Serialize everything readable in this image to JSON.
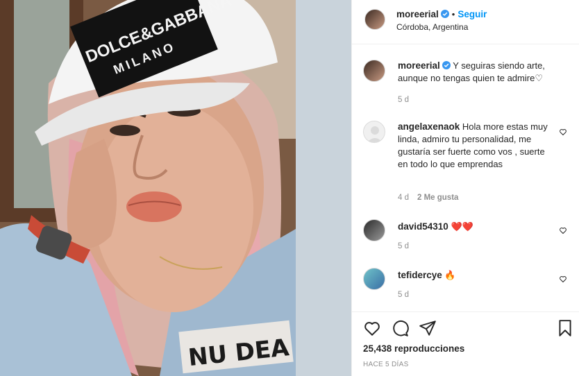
{
  "post": {
    "author": "moreerial",
    "follow_label": "Seguir",
    "separator": "•",
    "location": "Córdoba, Argentina",
    "caption": "Y seguiras siendo arte, aunque no tengas quien te admire♡",
    "caption_age": "5 d"
  },
  "photo": {
    "cap_brand_top": "DOLCE&GABBANA",
    "cap_brand_bottom": "MILANO",
    "jacket_patch": "NU DEA"
  },
  "comments": [
    {
      "user": "angelaxenaok",
      "text": "Hola more estas muy linda, admiro tu personalidad, me gustaría ser fuerte como vos , suerte en todo lo que emprendas",
      "age": "4 d",
      "likes": "2 Me gusta"
    },
    {
      "user": "david54310",
      "text": "❤️❤️",
      "age": "5 d"
    },
    {
      "user": "tefidercye",
      "text": "🔥",
      "age": "5 d"
    }
  ],
  "stats": {
    "views": "25,438 reproducciones",
    "posted": "HACE 5 DÍAS"
  },
  "icons": {
    "like": "heart-icon",
    "comment": "comment-icon",
    "share": "send-icon",
    "save": "bookmark-icon",
    "verified": "verified-badge-icon"
  },
  "colors": {
    "accent": "#0095f6",
    "verified": "#3897f0",
    "muted": "#8e8e8e",
    "heart_red": "#ed4956"
  }
}
